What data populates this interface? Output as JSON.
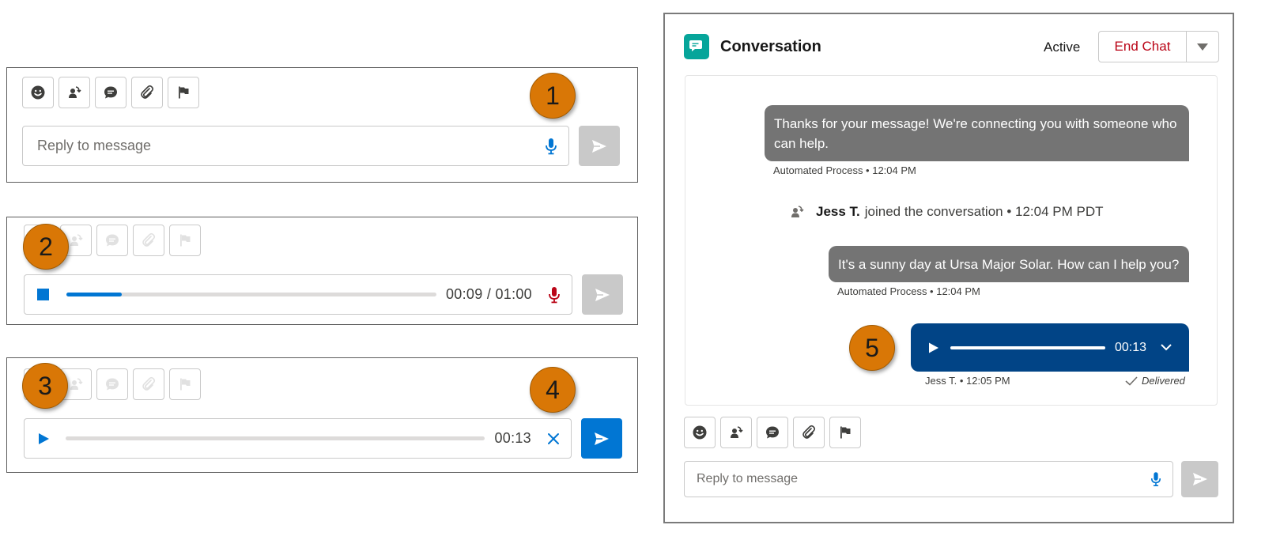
{
  "composer_default": {
    "placeholder": "Reply to message",
    "step_number": "1"
  },
  "composer_recording": {
    "step_number": "2",
    "time": "00:09 / 01:00",
    "progress_fraction": 0.15
  },
  "composer_review": {
    "step_number": "3",
    "send_step_number": "4",
    "time": "00:13"
  },
  "toolbar_icons": [
    "emoji-icon",
    "transfer-icon",
    "quick-text-icon",
    "attachment-icon",
    "flag-icon"
  ],
  "conversation": {
    "title": "Conversation",
    "status": "Active",
    "end_chat_label": "End Chat",
    "messages": [
      {
        "text": "Thanks for your message! We're connecting you with someone who can help.",
        "meta": "Automated Process • 12:04 PM"
      },
      {
        "text": "It's a sunny day at Ursa Major Solar. How can I help you?",
        "meta": "Automated Process • 12:04 PM"
      }
    ],
    "event": {
      "name": "Jess T.",
      "text": "joined the conversation • 12:04 PM PDT"
    },
    "voice_message": {
      "step_number": "5",
      "duration": "00:13",
      "meta": "Jess T. • 12:05 PM",
      "status": "Delivered"
    },
    "placeholder": "Reply to message"
  },
  "colors": {
    "brand_blue": "#0176d3",
    "dark_blue": "#014486",
    "badge_orange": "#d97706",
    "teal": "#06a59a",
    "destructive": "#ba0517",
    "bubble_gray": "#747474"
  }
}
